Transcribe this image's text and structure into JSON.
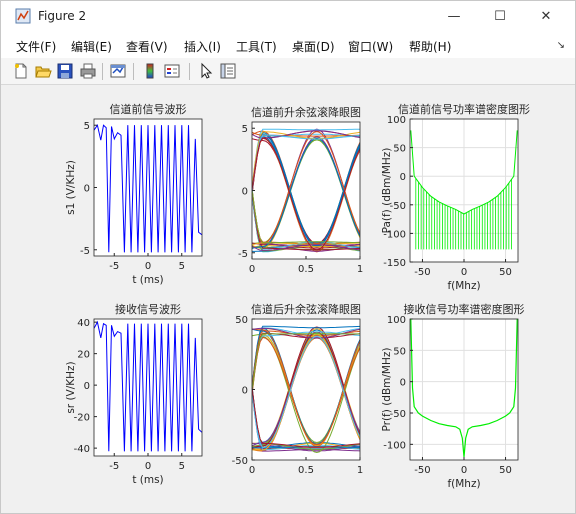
{
  "window": {
    "title": "Figure 2",
    "minimize_glyph": "—",
    "maximize_glyph": "☐",
    "close_glyph": "✕"
  },
  "menu": {
    "items": [
      "文件(F)",
      "编辑(E)",
      "查看(V)",
      "插入(I)",
      "工具(T)",
      "桌面(D)",
      "窗口(W)",
      "帮助(H)"
    ],
    "overflow_glyph": "↘"
  },
  "toolbar": {
    "icons": [
      "new-figure-icon",
      "open-file-icon",
      "save-icon",
      "print-icon",
      "link-plot-icon",
      "insert-colorbar-icon",
      "insert-legend-icon",
      "pointer-icon",
      "property-editor-icon"
    ]
  },
  "colors": {
    "signal": "#0000ff",
    "psd": "#00ee00",
    "axis": "#262626",
    "grid": "#e0e0e0"
  },
  "chart_data": [
    {
      "type": "line",
      "title": "信道前信号波形",
      "xlabel": "t (ms)",
      "ylabel": "s1  (V/KHz)",
      "xlim": [
        -8,
        8
      ],
      "ylim": [
        -5.5,
        5.5
      ],
      "xticks": [
        -5,
        0,
        5
      ],
      "yticks": [
        -5,
        0,
        5
      ],
      "series": [
        {
          "x": [
            -8,
            -7.5,
            -7,
            -6.6,
            -6.2,
            -5.8,
            -5.4,
            -5,
            -4.5,
            -4,
            -3.5,
            -3,
            -2.5,
            -2,
            -1.5,
            -1,
            -0.5,
            0,
            0.5,
            1,
            1.5,
            2,
            2.5,
            3,
            3.5,
            4,
            4.5,
            5,
            5.5,
            6,
            6.5,
            7,
            7.5,
            8
          ],
          "y": [
            4.6,
            5,
            3.8,
            5,
            4.8,
            -5.2,
            4.9,
            3.9,
            4.4,
            4.2,
            -5.2,
            5,
            -5.2,
            5,
            -5.2,
            5,
            -5.2,
            5,
            -5.2,
            5,
            -5.2,
            5,
            -5.2,
            5,
            -5.2,
            5,
            -5.2,
            5,
            -5.2,
            5,
            -5.2,
            3.9,
            -3.6,
            -3.8
          ]
        }
      ]
    },
    {
      "type": "line",
      "title": "信道前升余弦滚降眼图",
      "xlabel": "",
      "ylabel": "",
      "xlim": [
        0,
        1
      ],
      "ylim": [
        -5.5,
        5.5
      ],
      "xticks": [
        0,
        0.5,
        1
      ],
      "yticks": [
        -5,
        0,
        5
      ],
      "note": "eye diagram: many overlaid colored traces crossing near x=0.1 and x=0.6"
    },
    {
      "type": "line",
      "title": "信道前信号功率谱密度图形",
      "xlabel": "f(Mhz)",
      "ylabel": "Pa(f) (dBm/MHz)",
      "xlim": [
        -65,
        65
      ],
      "ylim": [
        -150,
        100
      ],
      "xticks": [
        -50,
        0,
        50
      ],
      "yticks": [
        -150,
        -100,
        -50,
        0,
        50,
        100
      ],
      "series": [
        {
          "x": [
            -64,
            -60,
            -50,
            -40,
            -30,
            -20,
            -10,
            -5,
            0,
            5,
            10,
            20,
            30,
            40,
            50,
            60,
            64
          ],
          "y": [
            80,
            0,
            -20,
            -35,
            -45,
            -52,
            -58,
            -62,
            -66,
            -62,
            -58,
            -52,
            -45,
            -35,
            -20,
            0,
            80
          ],
          "floor": -128
        }
      ]
    },
    {
      "type": "line",
      "title": "接收信号波形",
      "xlabel": "t (ms)",
      "ylabel": "sr  (V/KHz)",
      "xlim": [
        -8,
        8
      ],
      "ylim": [
        -45,
        42
      ],
      "xticks": [
        -5,
        0,
        5
      ],
      "yticks": [
        -40,
        -20,
        0,
        20,
        40
      ],
      "series": [
        {
          "x": [
            -8,
            -7.5,
            -7,
            -6.6,
            -6.2,
            -5.8,
            -5.4,
            -5,
            -4.5,
            -4,
            -3.5,
            -3,
            -2.5,
            -2,
            -1.5,
            -1,
            -0.5,
            0,
            0.5,
            1,
            1.5,
            2,
            2.5,
            3,
            3.5,
            4,
            4.5,
            5,
            5.5,
            6,
            6.5,
            7,
            7.5,
            8
          ],
          "y": [
            36,
            40,
            30,
            39,
            38,
            -42,
            38,
            31,
            34,
            33,
            -42,
            39,
            -42,
            39,
            -42,
            39,
            -42,
            39,
            -42,
            39,
            -42,
            39,
            -42,
            39,
            -42,
            39,
            -42,
            39,
            -42,
            39,
            -42,
            30,
            -28,
            -30
          ]
        }
      ]
    },
    {
      "type": "line",
      "title": "信道后升余弦滚降眼图",
      "xlabel": "",
      "ylabel": "",
      "xlim": [
        0,
        1
      ],
      "ylim": [
        -50,
        50
      ],
      "xticks": [
        0,
        0.5,
        1
      ],
      "yticks": [
        -50,
        0,
        50
      ],
      "note": "eye diagram: many overlaid colored traces crossing near x=0.1 and x=0.6"
    },
    {
      "type": "line",
      "title": "接收信号功率谱密度图形",
      "xlabel": "f(Mhz)",
      "ylabel": "Pr(f) (dBm/MHz)",
      "xlim": [
        -65,
        65
      ],
      "ylim": [
        -125,
        100
      ],
      "xticks": [
        -50,
        0,
        50
      ],
      "yticks": [
        -100,
        -50,
        0,
        50,
        100
      ],
      "series": [
        {
          "x": [
            -64,
            -62,
            -60,
            -55,
            -50,
            -40,
            -30,
            -20,
            -10,
            -5,
            -2,
            0,
            2,
            5,
            10,
            20,
            30,
            40,
            50,
            55,
            60,
            62,
            64
          ],
          "y": [
            100,
            -10,
            -40,
            -50,
            -55,
            -62,
            -67,
            -70,
            -72,
            -76,
            -90,
            -120,
            -90,
            -76,
            -72,
            -70,
            -67,
            -62,
            -55,
            -50,
            -40,
            -10,
            100
          ]
        }
      ]
    }
  ]
}
